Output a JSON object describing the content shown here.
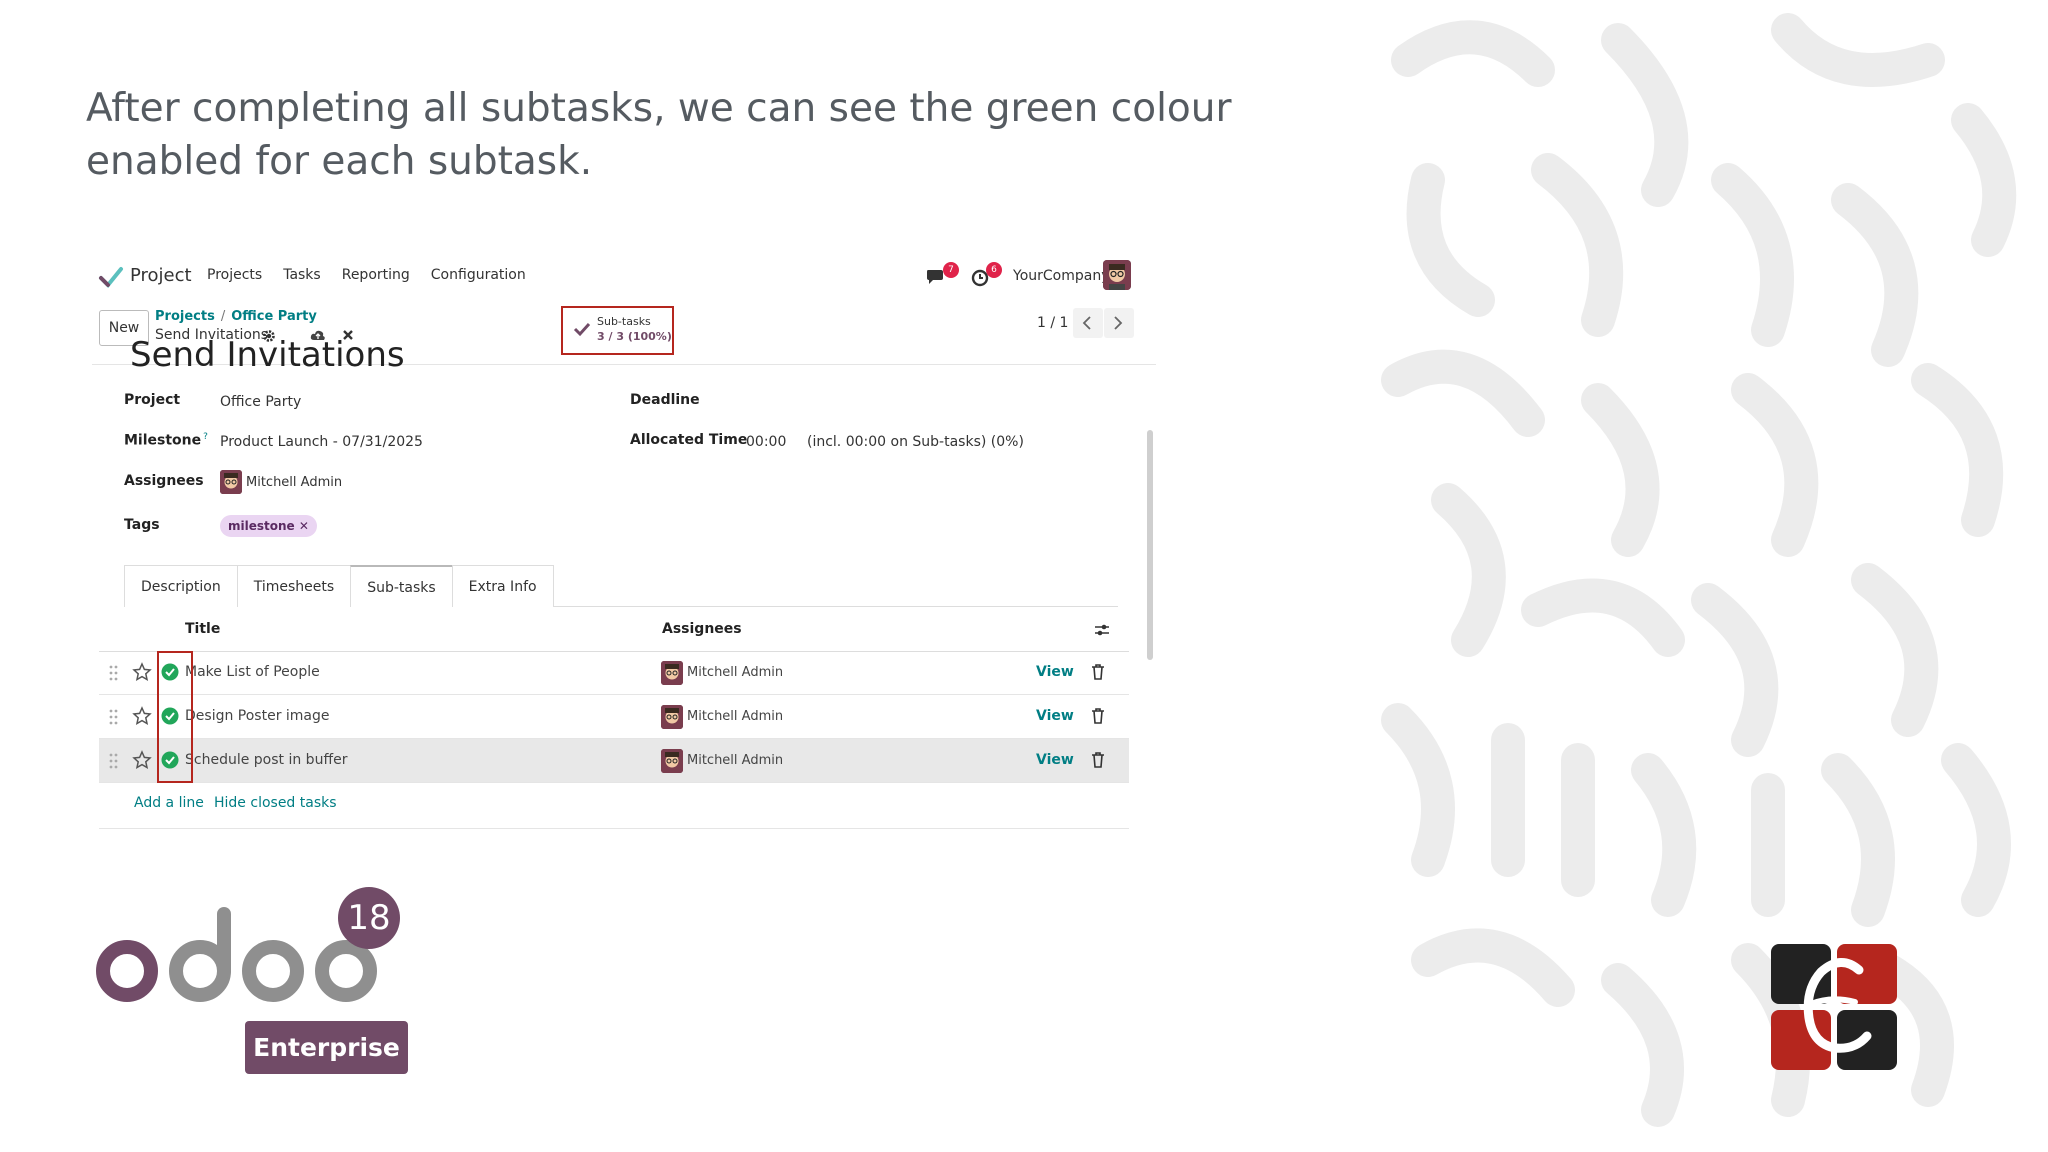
{
  "caption": "After completing all subtasks, we can see the green colour enabled for each subtask.",
  "navbar": {
    "app_name": "Project",
    "menu": [
      "Projects",
      "Tasks",
      "Reporting",
      "Configuration"
    ],
    "chat_badge": "7",
    "activity_badge": "6",
    "company": "YourCompany"
  },
  "control_panel": {
    "new_label": "New",
    "breadcrumb": [
      "Projects",
      "Office Party"
    ],
    "breadcrumb_sep": "/",
    "record_name": "Send Invitations",
    "pager": "1 / 1"
  },
  "smart_button": {
    "label": "Sub-tasks",
    "value": "3 / 3 (100%)"
  },
  "form": {
    "title": "Send Invitations",
    "project_label": "Project",
    "project_value": "Office Party",
    "milestone_label": "Milestone",
    "milestone_help": "?",
    "milestone_value": "Product Launch - 07/31/2025",
    "assignees_label": "Assignees",
    "assignees_value": "Mitchell Admin",
    "tags_label": "Tags",
    "tag_value": "milestone",
    "deadline_label": "Deadline",
    "allocated_label": "Allocated Time",
    "allocated_value": "00:00",
    "allocated_note": "(incl. 00:00 on Sub-tasks) (0%)"
  },
  "tabs": [
    "Description",
    "Timesheets",
    "Sub-tasks",
    "Extra Info"
  ],
  "active_tab": "Sub-tasks",
  "subtasks": {
    "columns": {
      "title": "Title",
      "assignees": "Assignees"
    },
    "rows": [
      {
        "title": "Make List of People",
        "assignee": "Mitchell Admin",
        "action": "View",
        "state": "done"
      },
      {
        "title": "Design Poster image",
        "assignee": "Mitchell Admin",
        "action": "View",
        "state": "done"
      },
      {
        "title": "Schedule post in buffer",
        "assignee": "Mitchell Admin",
        "action": "View",
        "state": "done"
      }
    ],
    "add_line": "Add a line",
    "hide_closed": "Hide closed tasks"
  },
  "branding": {
    "version": "18",
    "edition": "Enterprise",
    "odoo_color": "#714b67",
    "accent_red": "#b5261e",
    "done_green": "#21a65a"
  }
}
